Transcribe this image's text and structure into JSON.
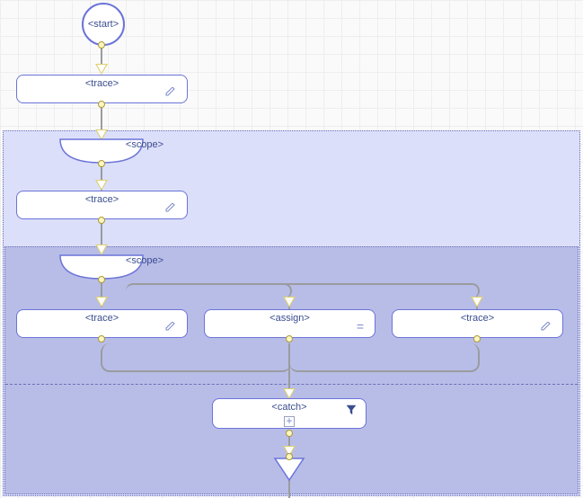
{
  "start": {
    "label": "<start>"
  },
  "trace1": {
    "label": "<trace>"
  },
  "scope1": {
    "label": "<scope>"
  },
  "trace2": {
    "label": "<trace>"
  },
  "scope2": {
    "label": "<scope>"
  },
  "trace3": {
    "label": "<trace>"
  },
  "assign": {
    "label": "<assign>"
  },
  "trace4": {
    "label": "<trace>"
  },
  "catch": {
    "label": "<catch>"
  },
  "icons": {
    "equals": "=",
    "plus": "+"
  }
}
